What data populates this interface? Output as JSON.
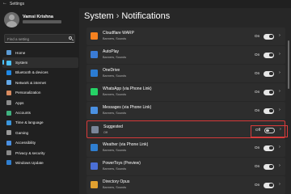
{
  "window": {
    "title": "Settings"
  },
  "profile": {
    "name": "Vamsi Krishna"
  },
  "search": {
    "placeholder": "Find a setting"
  },
  "nav": [
    {
      "label": "Home",
      "icon": "home-icon",
      "color": "#5b9bd5"
    },
    {
      "label": "System",
      "icon": "monitor-icon",
      "color": "#4cc2ff",
      "active": true
    },
    {
      "label": "Bluetooth & devices",
      "icon": "bluetooth-icon",
      "color": "#1e88e5"
    },
    {
      "label": "Network & internet",
      "icon": "network-icon",
      "color": "#62a8e8"
    },
    {
      "label": "Personalization",
      "icon": "brush-icon",
      "color": "#d98b5f"
    },
    {
      "label": "Apps",
      "icon": "apps-icon",
      "color": "#8c8c8c"
    },
    {
      "label": "Accounts",
      "icon": "accounts-icon",
      "color": "#3fb27f"
    },
    {
      "label": "Time & language",
      "icon": "globe-clock-icon",
      "color": "#3a96dd"
    },
    {
      "label": "Gaming",
      "icon": "gaming-icon",
      "color": "#9a9a9a"
    },
    {
      "label": "Accessibility",
      "icon": "accessibility-icon",
      "color": "#4a90e2"
    },
    {
      "label": "Privacy & security",
      "icon": "shield-icon",
      "color": "#8a8a8a"
    },
    {
      "label": "Windows Update",
      "icon": "update-icon",
      "color": "#2f7fd1"
    }
  ],
  "breadcrumb": {
    "parent": "System",
    "separator": "›",
    "current": "Notifications"
  },
  "apps": [
    {
      "name": "Cloudflare WARP",
      "sub": "Banners, Sounds",
      "state": "On",
      "on": true,
      "icon_color": "#f48120"
    },
    {
      "name": "AutoPlay",
      "sub": "Banners, Sounds",
      "state": "On",
      "on": true,
      "icon_color": "#3a7bd5"
    },
    {
      "name": "OneDrive",
      "sub": "Banners, Sounds",
      "state": "On",
      "on": true,
      "icon_color": "#2b7cd3"
    },
    {
      "name": "WhatsApp (via Phone Link)",
      "sub": "Banners, Sounds",
      "state": "On",
      "on": true,
      "icon_color": "#25d366"
    },
    {
      "name": "Messages (via Phone Link)",
      "sub": "Banners, Sounds",
      "state": "On",
      "on": true,
      "icon_color": "#4a90e2"
    },
    {
      "name": "Suggested",
      "sub": "Off",
      "state": "Off",
      "on": false,
      "icon_color": "#7a8699",
      "highlight": true
    },
    {
      "name": "Weather (via Phone Link)",
      "sub": "Banners, Sounds",
      "state": "On",
      "on": true,
      "icon_color": "#2f7fd1"
    },
    {
      "name": "PowerToys (Preview)",
      "sub": "Banners, Sounds",
      "state": "On",
      "on": true,
      "icon_color": "#4b6fd6"
    },
    {
      "name": "Directory Opus",
      "sub": "Banners, Sounds",
      "state": "On",
      "on": true,
      "icon_color": "#e0a030"
    }
  ]
}
